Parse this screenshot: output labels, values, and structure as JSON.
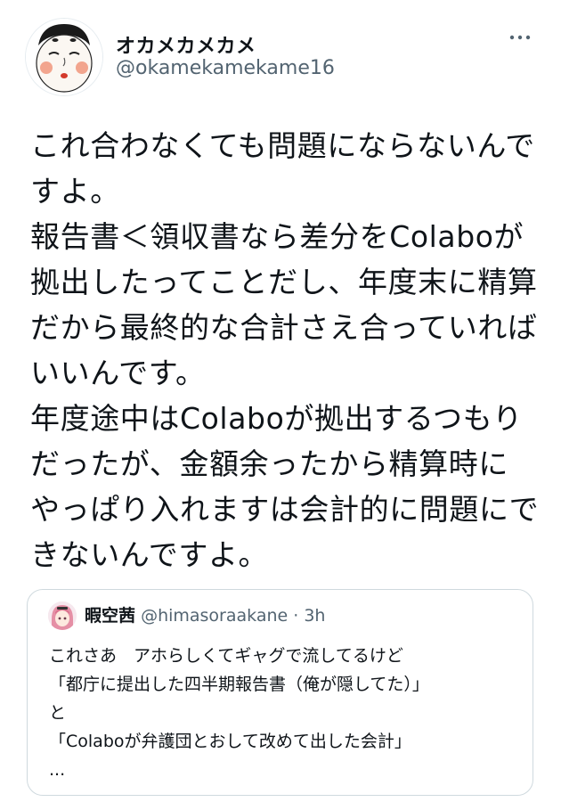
{
  "author": {
    "display_name": "オカメカメカメ",
    "handle": "@okamekamekame16",
    "avatar_icon": "okame-mask-avatar"
  },
  "more_icon": "more-horizontal-icon",
  "tweet": {
    "lines": [
      "これ合わなくても問題にならないんで",
      "すよ。",
      "報告書＜領収書なら差分をColaboが",
      "拠出したってことだし、年度末に精算",
      "だから最終的な合計さえ合っていれば",
      "いいんです。",
      "年度途中はColaboが拠出するつもり",
      "だったが、金額余ったから精算時に",
      "やっぱり入れますは会計的に問題にで",
      "きないんですよ。"
    ]
  },
  "quote": {
    "display_name": "暇空茜",
    "handle": "@himasoraakane",
    "separator": "·",
    "time": "3h",
    "avatar_icon": "anime-girl-avatar",
    "lines": [
      "これさあ　アホらしくてギャグで流してるけど",
      "「都庁に提出した四半期報告書（俺が隠してた）」",
      "と",
      "「Colaboが弁護団とおして改めて出した会計」",
      "..."
    ]
  },
  "colors": {
    "text": "#0f1419",
    "secondary": "#536471",
    "border": "#cfd9de"
  }
}
